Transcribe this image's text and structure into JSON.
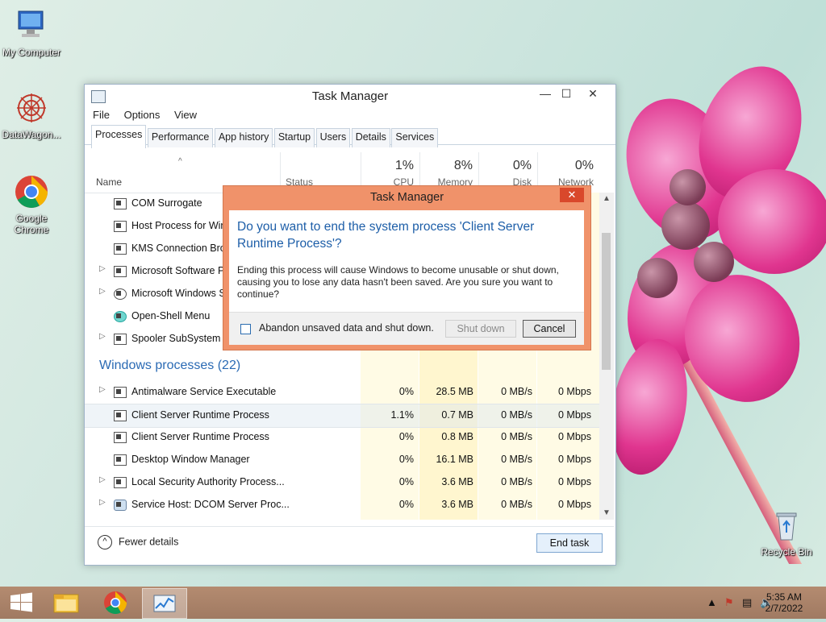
{
  "desktop": {
    "icons": [
      {
        "label": "My Computer"
      },
      {
        "label": "DataWagon..."
      },
      {
        "label": "Google Chrome"
      },
      {
        "label": "Recycle Bin"
      }
    ]
  },
  "window": {
    "title": "Task Manager",
    "menu": [
      "File",
      "Options",
      "View"
    ],
    "tabs": [
      "Processes",
      "Performance",
      "App history",
      "Startup",
      "Users",
      "Details",
      "Services"
    ],
    "active_tab": "Processes",
    "columns": {
      "name": "Name",
      "status": "Status",
      "cpu": {
        "label": "CPU",
        "pct": "1%"
      },
      "memory": {
        "label": "Memory",
        "pct": "8%"
      },
      "disk": {
        "label": "Disk",
        "pct": "0%"
      },
      "network": {
        "label": "Network",
        "pct": "0%"
      }
    },
    "bg_rows": [
      {
        "name": "COM Surrogate",
        "expand": false
      },
      {
        "name": "Host Process for Windows Tasks",
        "expand": false
      },
      {
        "name": "KMS Connection Broker",
        "expand": false
      },
      {
        "name": "Microsoft Software Protection Platform",
        "expand": true
      },
      {
        "name": "Microsoft Windows Search Indexer",
        "expand": true
      },
      {
        "name": "Open-Shell Menu",
        "expand": false
      },
      {
        "name": "Spooler SubSystem App",
        "expand": true
      }
    ],
    "group_label": "Windows processes (22)",
    "win_rows": [
      {
        "name": "Antimalware Service Executable",
        "cpu": "0%",
        "mem": "28.5 MB",
        "disk": "0 MB/s",
        "net": "0 Mbps",
        "expand": true
      },
      {
        "name": "Client Server Runtime Process",
        "cpu": "1.1%",
        "mem": "0.7 MB",
        "disk": "0 MB/s",
        "net": "0 Mbps",
        "expand": false
      },
      {
        "name": "Client Server Runtime Process",
        "cpu": "0%",
        "mem": "0.8 MB",
        "disk": "0 MB/s",
        "net": "0 Mbps",
        "expand": false
      },
      {
        "name": "Desktop Window Manager",
        "cpu": "0%",
        "mem": "16.1 MB",
        "disk": "0 MB/s",
        "net": "0 Mbps",
        "expand": false
      },
      {
        "name": "Local Security Authority Process...",
        "cpu": "0%",
        "mem": "3.6 MB",
        "disk": "0 MB/s",
        "net": "0 Mbps",
        "expand": true
      },
      {
        "name": "Service Host: DCOM Server Proc...",
        "cpu": "0%",
        "mem": "3.6 MB",
        "disk": "0 MB/s",
        "net": "0 Mbps",
        "expand": true
      }
    ],
    "fewer_details": "Fewer details",
    "end_task": "End task"
  },
  "dialog": {
    "title": "Task Manager",
    "close": "✕",
    "question": "Do you want to end the system process 'Client Server Runtime Process'?",
    "description": "Ending this process will cause Windows to become unusable or shut down, causing you to lose any data hasn't been saved. Are you sure you want to continue?",
    "checkbox_label": "Abandon unsaved data and shut down.",
    "shutdown_label": "Shut down",
    "cancel_label": "Cancel"
  },
  "taskbar": {
    "time": "5:35 AM",
    "date": "2/7/2022"
  }
}
